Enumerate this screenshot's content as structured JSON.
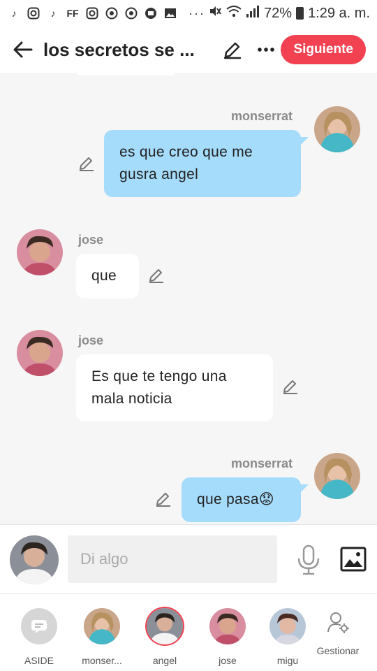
{
  "status_bar": {
    "battery": "72%",
    "time": "1:29 a. m.",
    "icons": [
      "tiktok-icon",
      "instagram-icon",
      "tiktok-icon",
      "ff-icon",
      "instagram-icon",
      "app-icon",
      "app-icon",
      "app-icon",
      "gallery-icon"
    ],
    "ff_label": "FF"
  },
  "header": {
    "title": "los secretos se ...",
    "next_label": "Siguiente"
  },
  "messages": [
    {
      "sender": "monserrat",
      "text_lines": [
        "es que creo que me",
        "gusra angel"
      ],
      "side": "me"
    },
    {
      "sender": "jose",
      "text_lines": [
        "que"
      ],
      "side": "them"
    },
    {
      "sender": "jose",
      "text_lines": [
        "Es que te tengo una",
        "mala noticia"
      ],
      "side": "them"
    },
    {
      "sender": "monserrat",
      "text_lines": [
        "que pasa😟"
      ],
      "side": "me"
    }
  ],
  "input": {
    "placeholder": "Di algo"
  },
  "characters": [
    {
      "label": "ASIDE"
    },
    {
      "label": "monser..."
    },
    {
      "label": "angel"
    },
    {
      "label": "jose"
    },
    {
      "label": "migu"
    }
  ],
  "manage_label": "Gestionar",
  "colors": {
    "accent": "#f24150",
    "bubble_me": "#a6dcfb",
    "bubble_them": "#ffffff",
    "background": "#f6f6f6"
  }
}
